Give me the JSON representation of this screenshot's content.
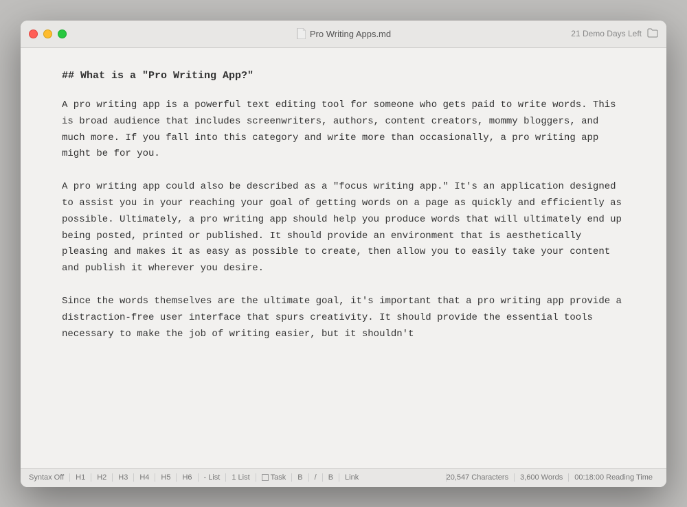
{
  "window": {
    "title": "Pro Writing Apps.md",
    "demo_label": "21 Demo Days Left"
  },
  "heading": "## What is a \"Pro Writing App?\"",
  "paragraphs": [
    "A pro writing app is a powerful text editing tool for someone who gets paid to write words. This is broad audience that includes screenwriters, authors, content creators, mommy bloggers, and much more. If you fall into this category and write more than occasionally, a pro writing app might be for you.",
    "A pro writing app could also be described as a \"focus writing app.\" It's an application designed to assist you in your reaching your goal of getting words on a page as quickly and efficiently as possible. Ultimately, a pro writing app should help you produce words that will ultimately end up being posted, printed or published. It should provide an environment that is aesthetically pleasing and makes it as easy as possible to create, then allow you to easily take your content and publish it wherever you desire.",
    "Since the words themselves are the ultimate goal, it's important that a pro writing app provide a distraction-free user interface that spurs creativity. It should provide the essential tools necessary to make the job of writing easier, but it shouldn't"
  ],
  "statusbar": {
    "syntax_off": "Syntax Off",
    "h1": "H1",
    "h2": "H2",
    "h3": "H3",
    "h4": "H4",
    "h5": "H5",
    "h6": "H6",
    "list": "- List",
    "num_list": "1 List",
    "task": "Task",
    "bold": "B",
    "italic": "/",
    "bold2": "B",
    "link": "Link",
    "characters": "20,547 Characters",
    "words": "3,600 Words",
    "reading_time": "00:18:00 Reading Time"
  }
}
